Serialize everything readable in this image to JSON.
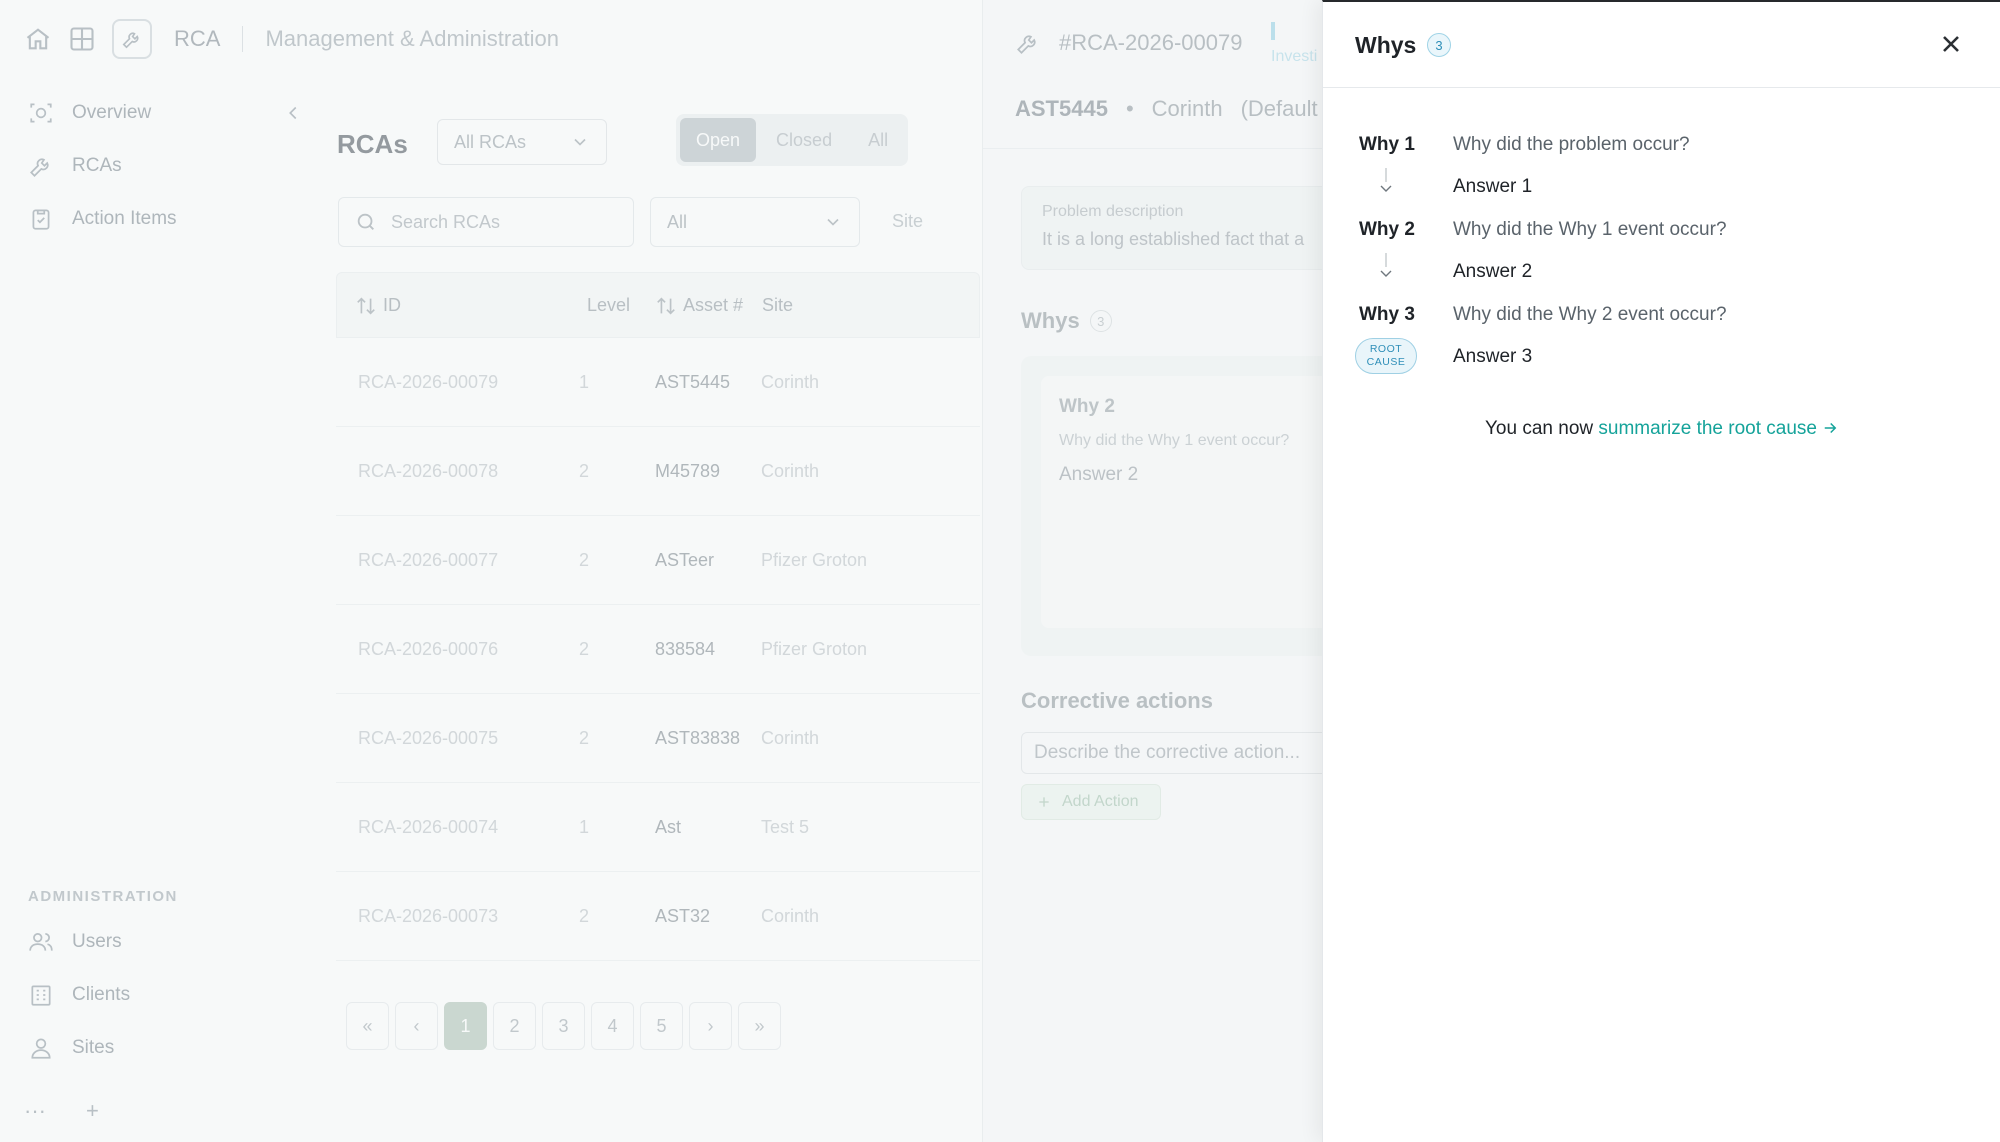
{
  "topbar": {
    "app_name": "RCA",
    "section": "Management & Administration"
  },
  "sidebar": {
    "items": [
      {
        "label": "Overview",
        "icon": "overview-icon"
      },
      {
        "label": "RCAs",
        "icon": "wrench-icon"
      },
      {
        "label": "Action Items",
        "icon": "clipboard-check-icon"
      }
    ],
    "admin_label": "ADMINISTRATION",
    "admin_items": [
      {
        "label": "Users",
        "icon": "users-icon"
      },
      {
        "label": "Clients",
        "icon": "building-icon"
      },
      {
        "label": "Sites",
        "icon": "user-pin-icon"
      }
    ],
    "footer_more": "···",
    "footer_add": "+"
  },
  "list": {
    "title": "RCAs",
    "scope_filter": "All RCAs",
    "segments": [
      "Open",
      "Closed",
      "All"
    ],
    "active_segment": "Open",
    "search_placeholder": "Search RCAs",
    "status_filter": "All",
    "site_filter": "Site",
    "columns": {
      "id": "ID",
      "level": "Level",
      "asset": "Asset #",
      "site": "Site"
    },
    "rows": [
      {
        "id": "RCA-2026-00079",
        "level": "1",
        "asset": "AST5445",
        "site": "Corinth"
      },
      {
        "id": "RCA-2026-00078",
        "level": "2",
        "asset": "M45789",
        "site": "Corinth"
      },
      {
        "id": "RCA-2026-00077",
        "level": "2",
        "asset": "ASTeer",
        "site": "Pfizer Groton"
      },
      {
        "id": "RCA-2026-00076",
        "level": "2",
        "asset": "838584",
        "site": "Pfizer Groton"
      },
      {
        "id": "RCA-2026-00075",
        "level": "2",
        "asset": "AST83838",
        "site": "Corinth"
      },
      {
        "id": "RCA-2026-00074",
        "level": "1",
        "asset": "Ast",
        "site": "Test 5"
      },
      {
        "id": "RCA-2026-00073",
        "level": "2",
        "asset": "AST32",
        "site": "Corinth"
      }
    ],
    "pager": {
      "first": "«",
      "prev": "‹",
      "pages": [
        "1",
        "2",
        "3",
        "4",
        "5"
      ],
      "current": "1",
      "next": "›",
      "last": "»"
    }
  },
  "detail": {
    "rca_id": "#RCA-2026-00079",
    "status": "Investi",
    "asset": "AST5445",
    "site": "Corinth",
    "site_suffix": "(Default C",
    "problem_label": "Problem description",
    "problem_text": "It is a long established fact that a",
    "whys_title": "Whys",
    "whys_count": "3",
    "why_card": {
      "title": "Why 2",
      "question": "Why did the Why 1 event occur?",
      "answer": "Answer 2"
    },
    "corrective_title": "Corrective actions",
    "corrective_placeholder": "Describe the corrective action...",
    "add_action": "Add Action"
  },
  "drawer": {
    "title": "Whys",
    "count": "3",
    "whys": [
      {
        "label": "Why 1",
        "question": "Why did the problem occur?",
        "answer": "Answer 1"
      },
      {
        "label": "Why 2",
        "question": "Why did the Why 1 event occur?",
        "answer": "Answer 2"
      },
      {
        "label": "Why 3",
        "question": "Why did the Why 2 event occur?",
        "answer": "Answer 3"
      }
    ],
    "root_cause_line1": "ROOT",
    "root_cause_line2": "CAUSE",
    "summary_prefix": "You can now ",
    "summary_link": "summarize the root cause"
  }
}
